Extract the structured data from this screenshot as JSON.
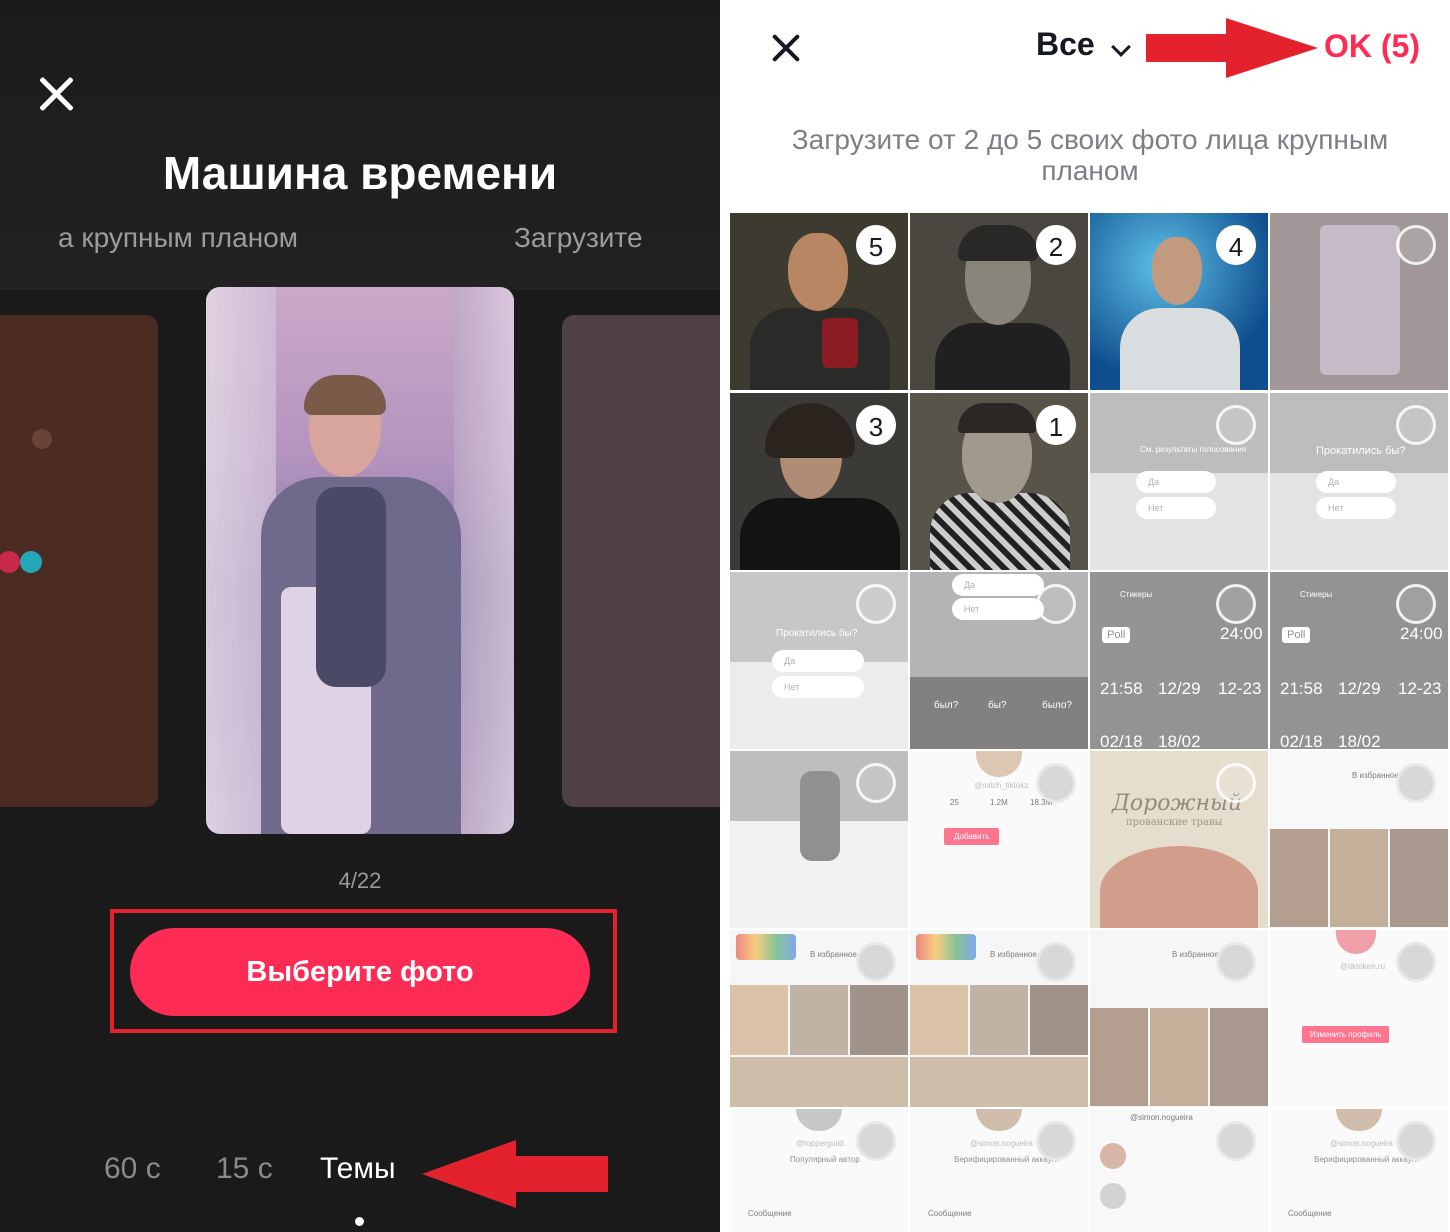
{
  "left": {
    "title": "Машина времени",
    "subtitle_left": "а крупным планом",
    "subtitle_right": "Загрузите",
    "counter": "4/22",
    "cta_label": "Выберите фото",
    "tabs": [
      "60 с",
      "15 с",
      "Темы"
    ],
    "active_tab": "Темы"
  },
  "right": {
    "album_label": "Все",
    "ok_label": "OK (5)",
    "hint": "Загрузите от 2 до 5 своих фото лица крупным планом",
    "grid": {
      "selected_numbers": [
        "5",
        "2",
        "4",
        "1",
        "3"
      ],
      "thumb_texts": {
        "poll_question": "Прокатились бы?",
        "poll_results": "См. результаты голосования",
        "poll_yes": "Да",
        "poll_no": "Нет",
        "keyboard_suggest": [
          "был?",
          "бы?",
          "было?"
        ],
        "stickers": "Стикеры",
        "poll_chip": "Poll",
        "clock_a": "24:00",
        "clock_b": "21:58",
        "clock_c": "12/29",
        "clock_d": "12-23",
        "clock_e": "02/18",
        "clock_f": "18/02",
        "username_1": "@mitch_tiktokz",
        "stat_1": "25",
        "stat_2": "1.2M",
        "stat_3": "18.3M",
        "add_btn": "Добавить",
        "favorites": "В избранное",
        "book_title": "Дорожный",
        "book_sub": "прованские травы",
        "username_2": "@tiktoken.ru",
        "profile_btn": "Изменить профиль",
        "username_3": "@topperguild",
        "username_4": "@simon.nogueira",
        "popular": "Популярный автор",
        "verified": "Верифицированный аккаунт",
        "message": "Сообщение"
      }
    }
  },
  "colors": {
    "accent": "#fe2c55",
    "annotation_red": "#e4222e",
    "left_bg": "#1a1a1a"
  },
  "icons": {
    "close": "close-icon",
    "chevron": "chevron-down-icon",
    "annotation_arrow": "arrow-annotation"
  }
}
